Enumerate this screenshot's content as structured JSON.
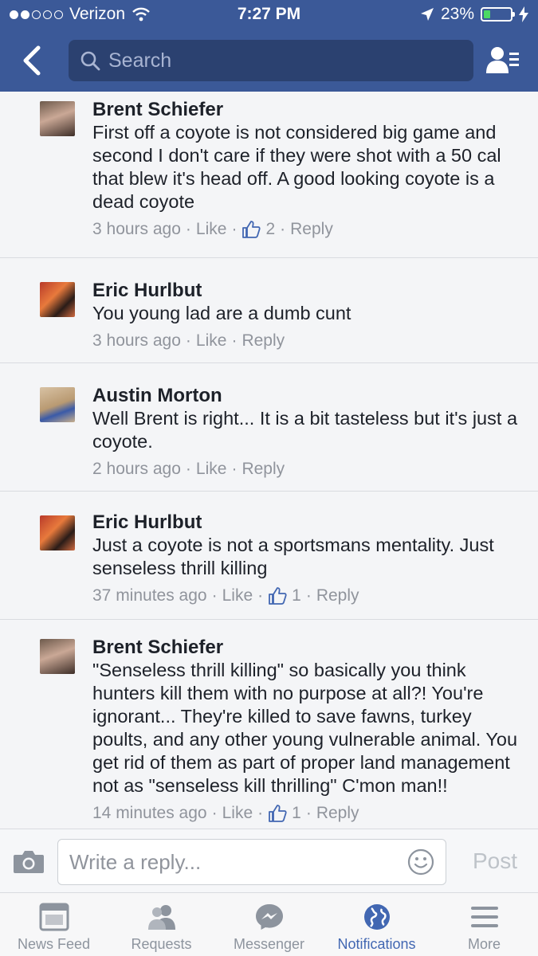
{
  "status_bar": {
    "carrier": "Verizon",
    "time": "7:27 PM",
    "battery_text": "23%",
    "battery_level": 0.23
  },
  "header": {
    "search_placeholder": "Search"
  },
  "comments": [
    {
      "author": "Brent Schiefer",
      "text": "First off a coyote is not considered big game and second I don't care if they were shot with a 50 cal that blew it's head off. A good looking coyote is a dead coyote",
      "time": "3 hours ago",
      "like": "Like",
      "reactions": "2",
      "reply": "Reply"
    },
    {
      "author": "Eric Hurlbut",
      "text": "You young lad are a dumb cunt",
      "time": "3 hours ago",
      "like": "Like",
      "reactions": "",
      "reply": "Reply"
    },
    {
      "author": "Austin Morton",
      "text": "Well Brent is right... It is a bit tasteless but it's just a coyote.",
      "time": "2 hours ago",
      "like": "Like",
      "reactions": "",
      "reply": "Reply"
    },
    {
      "author": "Eric Hurlbut",
      "text": "Just a coyote is not a sportsmans mentality. Just senseless thrill killing",
      "time": "37 minutes ago",
      "like": "Like",
      "reactions": "1",
      "reply": "Reply"
    },
    {
      "author": "Brent Schiefer",
      "text": "\"Senseless thrill killing\" so basically you think hunters kill them with no purpose at all?! You're ignorant... They're killed to save fawns, turkey poults, and any other young vulnerable animal. You get rid of them as part of proper land management not as \"senseless kill thrilling\" C'mon man!!",
      "time": "14 minutes ago",
      "like": "Like",
      "reactions": "1",
      "reply": "Reply"
    }
  ],
  "reply_bar": {
    "placeholder": "Write a reply...",
    "post_label": "Post"
  },
  "tabs": [
    {
      "label": "News Feed",
      "icon": "news-feed-icon"
    },
    {
      "label": "Requests",
      "icon": "friend-requests-icon"
    },
    {
      "label": "Messenger",
      "icon": "messenger-icon"
    },
    {
      "label": "Notifications",
      "icon": "globe-icon",
      "active": true
    },
    {
      "label": "More",
      "icon": "menu-icon"
    }
  ],
  "colors": {
    "header_bg": "#3b5998",
    "active_tab": "#4267b2",
    "meta_text": "#90949c",
    "battery_fill": "#4cd964"
  }
}
